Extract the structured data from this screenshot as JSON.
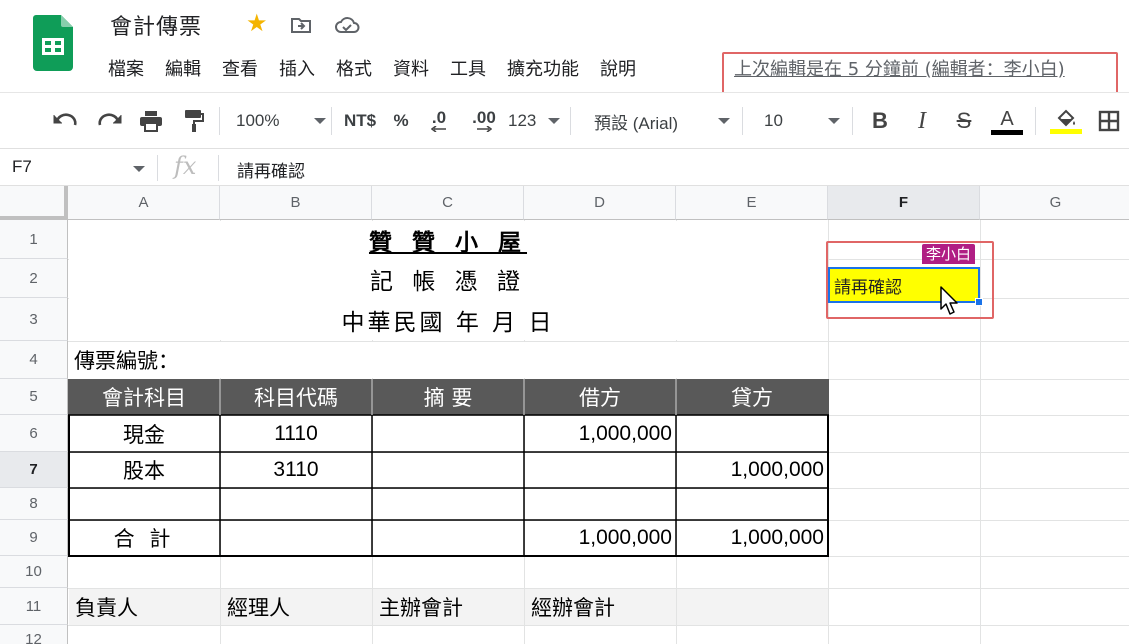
{
  "app": {
    "doc_title": "會計傳票",
    "icons": [
      "sheets-logo-icon",
      "star-icon",
      "move-folder-icon",
      "cloud-saved-icon"
    ],
    "star_color": "#f4b400",
    "brand_color": "#0f9d58"
  },
  "menu": {
    "items": [
      "檔案",
      "編輯",
      "查看",
      "插入",
      "格式",
      "資料",
      "工具",
      "擴充功能",
      "說明"
    ],
    "last_edit": "上次編輯是在 5 分鐘前 (編輯者：李小白)"
  },
  "toolbar": {
    "zoom": "100%",
    "currency": "NT$",
    "percent": "%",
    "decrease_decimal": ".0",
    "increase_decimal": ".00",
    "more_formats": "123",
    "font": "預設 (Arial)",
    "font_size": "10",
    "text_color": "#000000",
    "fill_color": "#ffff00"
  },
  "formula_bar": {
    "cell_ref": "F7",
    "fx": "fx",
    "value": "請再確認"
  },
  "grid": {
    "columns": [
      "A",
      "B",
      "C",
      "D",
      "E",
      "F",
      "G"
    ],
    "rows": [
      "1",
      "2",
      "3",
      "4",
      "5",
      "6",
      "7",
      "8",
      "9",
      "10",
      "11",
      "12"
    ],
    "selected_column": "F",
    "selected_row": "7"
  },
  "sheet": {
    "shop_name": "贊 贊 小 屋",
    "subtitle": "記 帳 憑 證",
    "date_line": "中華民國 年 月 日",
    "voucher_no_label": "傳票編號：",
    "headers": [
      "會計科目",
      "科目代碼",
      "摘 要",
      "借方",
      "貸方"
    ],
    "rows": [
      [
        "現金",
        "1110",
        "",
        "1,000,000",
        ""
      ],
      [
        "股本",
        "3110",
        "",
        "",
        "1,000,000"
      ],
      [
        "",
        "",
        "",
        "",
        ""
      ],
      [
        "合 計",
        "",
        "",
        "1,000,000",
        "1,000,000"
      ]
    ],
    "signatures": [
      "負責人",
      "經理人",
      "主辦會計",
      "經辦會計",
      ""
    ],
    "header_bg": "#595959"
  },
  "collaborator": {
    "name": "李小白",
    "color": "#b01e84",
    "cell": "F7",
    "cell_value": "請再確認",
    "cell_bg": "#ffff00"
  }
}
